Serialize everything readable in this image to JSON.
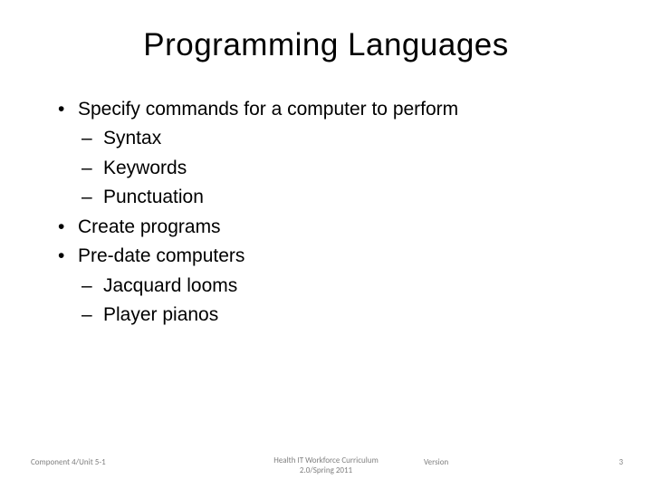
{
  "title": "Programming Languages",
  "bullets": {
    "b0": "Specify commands for a computer to perform",
    "b0_0": "Syntax",
    "b0_1": "Keywords",
    "b0_2": "Punctuation",
    "b1": "Create programs",
    "b2": "Pre-date computers",
    "b2_0": "Jacquard looms",
    "b2_1": "Player pianos"
  },
  "footer": {
    "left": "Component 4/Unit 5-1",
    "center_line1": "Health IT Workforce Curriculum",
    "center_line2": "2.0/Spring 2011",
    "version": "Version",
    "page": "3"
  }
}
